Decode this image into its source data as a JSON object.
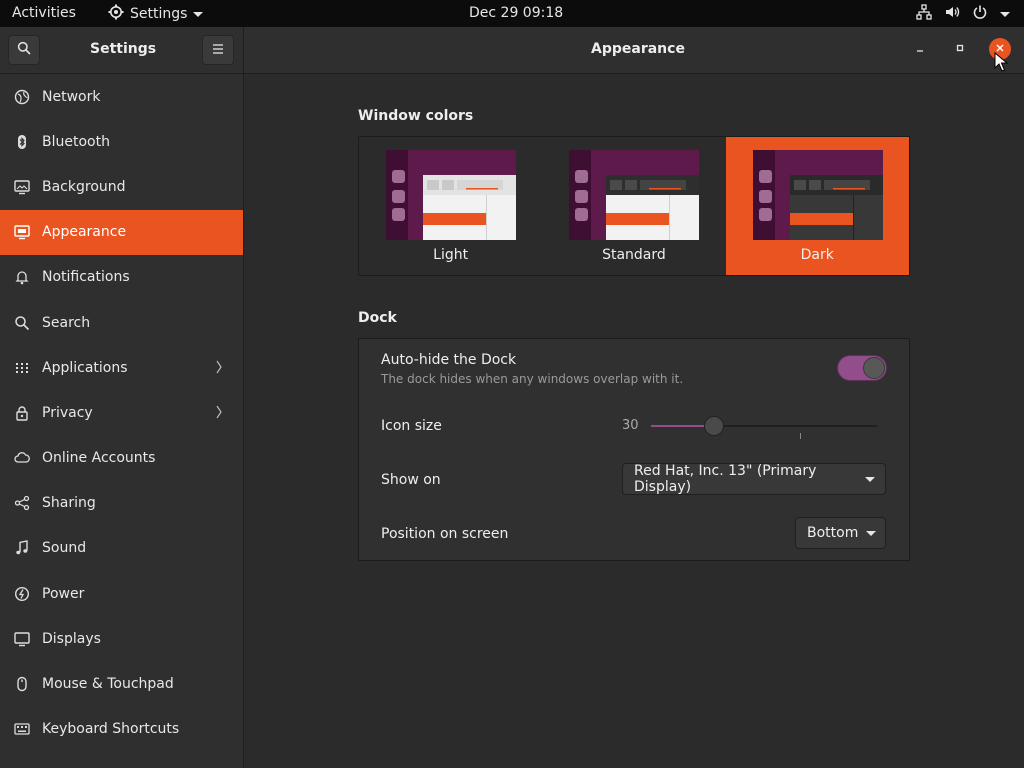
{
  "topbar": {
    "activities": "Activities",
    "app_menu": "Settings",
    "clock": "Dec 29  09:18",
    "icons": [
      "network-icon",
      "volume-icon",
      "power-icon"
    ]
  },
  "sidebar_header": {
    "title": "Settings"
  },
  "main_header": {
    "title": "Appearance"
  },
  "sidebar": {
    "items": [
      {
        "label": "Network",
        "icon": "globe-icon"
      },
      {
        "label": "Bluetooth",
        "icon": "bluetooth-icon"
      },
      {
        "label": "Background",
        "icon": "monitor-icon"
      },
      {
        "label": "Appearance",
        "icon": "appearance-icon",
        "active": true
      },
      {
        "label": "Notifications",
        "icon": "bell-icon"
      },
      {
        "label": "Search",
        "icon": "search-icon"
      },
      {
        "label": "Applications",
        "icon": "grid-icon",
        "has_submenu": true
      },
      {
        "label": "Privacy",
        "icon": "lock-icon",
        "has_submenu": true
      },
      {
        "label": "Online Accounts",
        "icon": "cloud-icon"
      },
      {
        "label": "Sharing",
        "icon": "share-icon"
      },
      {
        "label": "Sound",
        "icon": "music-note-icon"
      },
      {
        "label": "Power",
        "icon": "power-icon"
      },
      {
        "label": "Displays",
        "icon": "display-icon"
      },
      {
        "label": "Mouse & Touchpad",
        "icon": "mouse-icon"
      },
      {
        "label": "Keyboard Shortcuts",
        "icon": "keyboard-icon"
      }
    ]
  },
  "window_colors": {
    "title": "Window colors",
    "options": [
      {
        "label": "Light",
        "selected": false
      },
      {
        "label": "Standard",
        "selected": false
      },
      {
        "label": "Dark",
        "selected": true
      }
    ]
  },
  "dock": {
    "title": "Dock",
    "autohide": {
      "label": "Auto-hide the Dock",
      "description": "The dock hides when any windows overlap with it.",
      "enabled": true
    },
    "icon_size": {
      "label": "Icon size",
      "value": "30",
      "fraction": 0.28
    },
    "show_on": {
      "label": "Show on",
      "value": "Red Hat, Inc. 13\" (Primary Display)"
    },
    "position": {
      "label": "Position on screen",
      "value": "Bottom"
    }
  },
  "colors": {
    "accent": "#e95420",
    "toggle_on": "#924d8b",
    "thumb_aubergine": "#5e1a4a"
  }
}
